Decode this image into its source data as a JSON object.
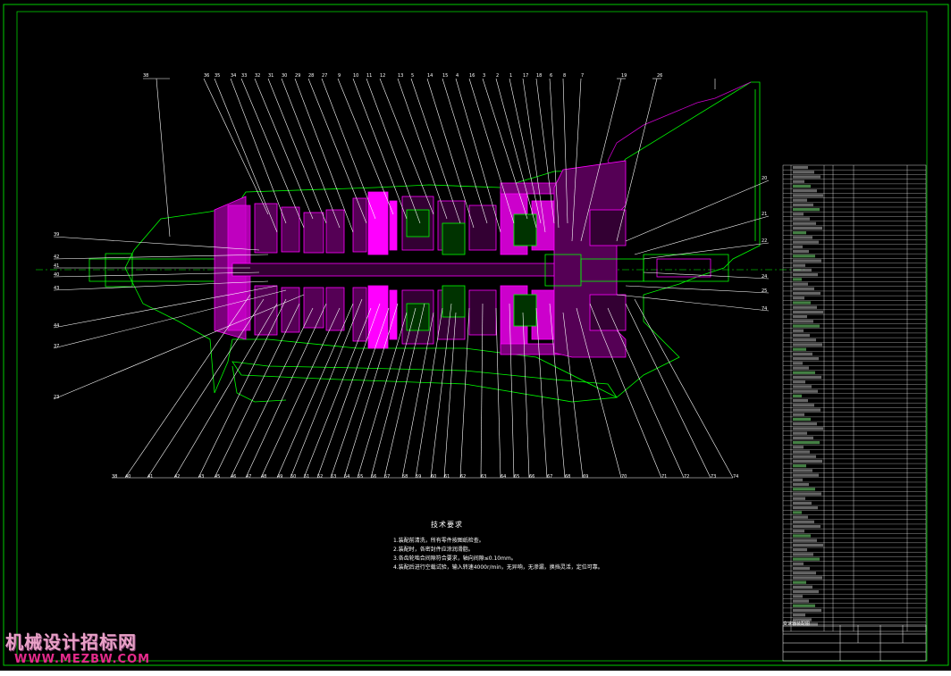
{
  "drawing": {
    "tech_title": "技术要求",
    "tech_notes": [
      "1.装配前清洗，所有零件按图纸检查。",
      "2.装配时，各密封件应涂润滑脂。",
      "3.各齿轮啮合间隙符合要求，轴向间隙≤0.10mm。",
      "4.装配后进行空载试验，输入转速4000r/min，无异响，无渗漏，换挡灵活，定位可靠。"
    ],
    "titleblock_label": "变速器装配图",
    "top_callouts": [
      "38",
      "36",
      "35",
      "34",
      "33",
      "32",
      "31",
      "30",
      "29",
      "28",
      "27",
      "9",
      "10",
      "11",
      "12",
      "13",
      "5",
      "14",
      "15",
      "4",
      "16",
      "3",
      "2",
      "1",
      "17",
      "18",
      "6",
      "8",
      "7",
      "19",
      "26"
    ],
    "left_callouts": [
      "39",
      "42",
      "41",
      "40",
      "43",
      "44",
      "37",
      "23"
    ],
    "right_callouts": [
      "20",
      "21",
      "22",
      "24",
      "25",
      "74"
    ],
    "bottom_callouts": [
      "38",
      "40",
      "41",
      "42",
      "43",
      "45",
      "46",
      "47",
      "48",
      "49",
      "50",
      "51",
      "52",
      "53",
      "54",
      "55",
      "56",
      "57",
      "58",
      "59",
      "60",
      "61",
      "62",
      "63",
      "64",
      "65",
      "66",
      "67",
      "68",
      "69",
      "70",
      "71",
      "72",
      "73",
      "74"
    ],
    "bom_rows": 100
  },
  "watermark": {
    "name": "机械设计招标网",
    "url": "WWW.MEZBW.COM"
  },
  "colors": {
    "background": "#000000",
    "border": "#00cc00",
    "magenta": "#ff00ff",
    "green": "#00ff00",
    "white": "#ffffff"
  }
}
